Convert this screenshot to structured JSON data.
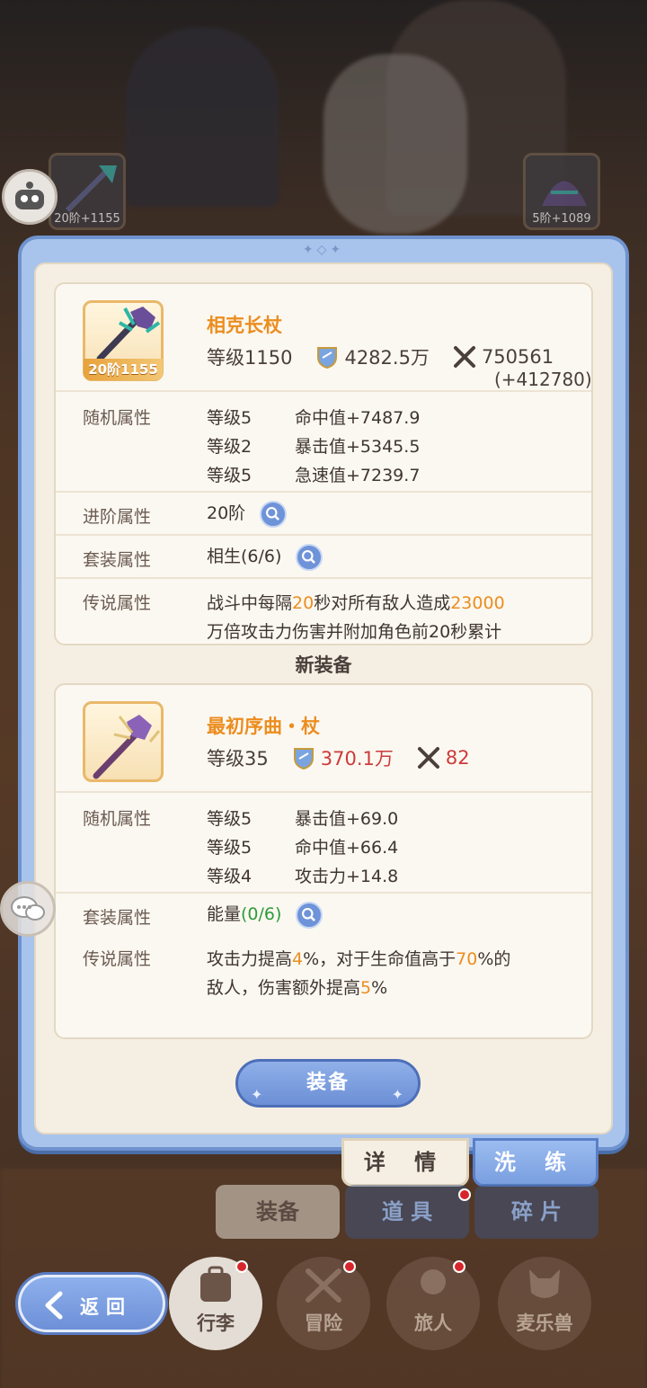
{
  "topbar": {
    "left_item_level": "20阶+1155",
    "right_item_level": "5阶+1089"
  },
  "current_item": {
    "name": "相克长杖",
    "icon_badge": "20阶1155",
    "level": "等级1150",
    "power": "4282.5万",
    "attack": "750561",
    "attack_bonus": "(+412780)",
    "random_label": "随机属性",
    "random_attrs": [
      {
        "level": "等级5",
        "stat": "命中值+7487.9"
      },
      {
        "level": "等级2",
        "stat": "暴击值+5345.5"
      },
      {
        "level": "等级5",
        "stat": "急速值+7239.7"
      }
    ],
    "advance_label": "进阶属性",
    "advance_value": "20阶",
    "set_label": "套装属性",
    "set_value": "相生(6/6)",
    "legend_label": "传说属性",
    "legend_line1_a": "战斗中每隔",
    "legend_line1_b": "20",
    "legend_line1_c": "秒对所有敌人造成",
    "legend_line1_d": "23000",
    "legend_line2": "万倍攻击力伤害并附加角色前20秒累计"
  },
  "new_section_title": "新装备",
  "new_item": {
    "name": "最初序曲・杖",
    "level": "等级35",
    "power": "370.1万",
    "attack": "82",
    "random_label": "随机属性",
    "random_attrs": [
      {
        "level": "等级5",
        "stat": "暴击值+69.0"
      },
      {
        "level": "等级5",
        "stat": "命中值+66.4"
      },
      {
        "level": "等级4",
        "stat": "攻击力+14.8"
      }
    ],
    "set_label": "套装属性",
    "set_name": "能量",
    "set_progress": "(0/6)",
    "legend_label": "传说属性",
    "legend_line1_a": "攻击力提高",
    "legend_line1_b": "4",
    "legend_line1_c": "%，对于生命值高于",
    "legend_line1_d": "70",
    "legend_line1_e": "%的",
    "legend_line2_a": "敌人，伤害额外提高",
    "legend_line2_b": "5",
    "legend_line2_c": "%"
  },
  "equip_button": "装备",
  "panel_tabs": {
    "detail": "详 情",
    "wash": "洗 练"
  },
  "bottom_tabs": [
    "装备",
    "道 具",
    "碎 片"
  ],
  "nav": [
    "行李",
    "冒险",
    "旅人",
    "麦乐兽"
  ],
  "back_button": "返回",
  "colors": {
    "accent_orange": "#ec8d1f",
    "panel_blue": "#a8c4ec",
    "power_red": "#cc3b3b",
    "progress_green": "#2e9b3a"
  }
}
